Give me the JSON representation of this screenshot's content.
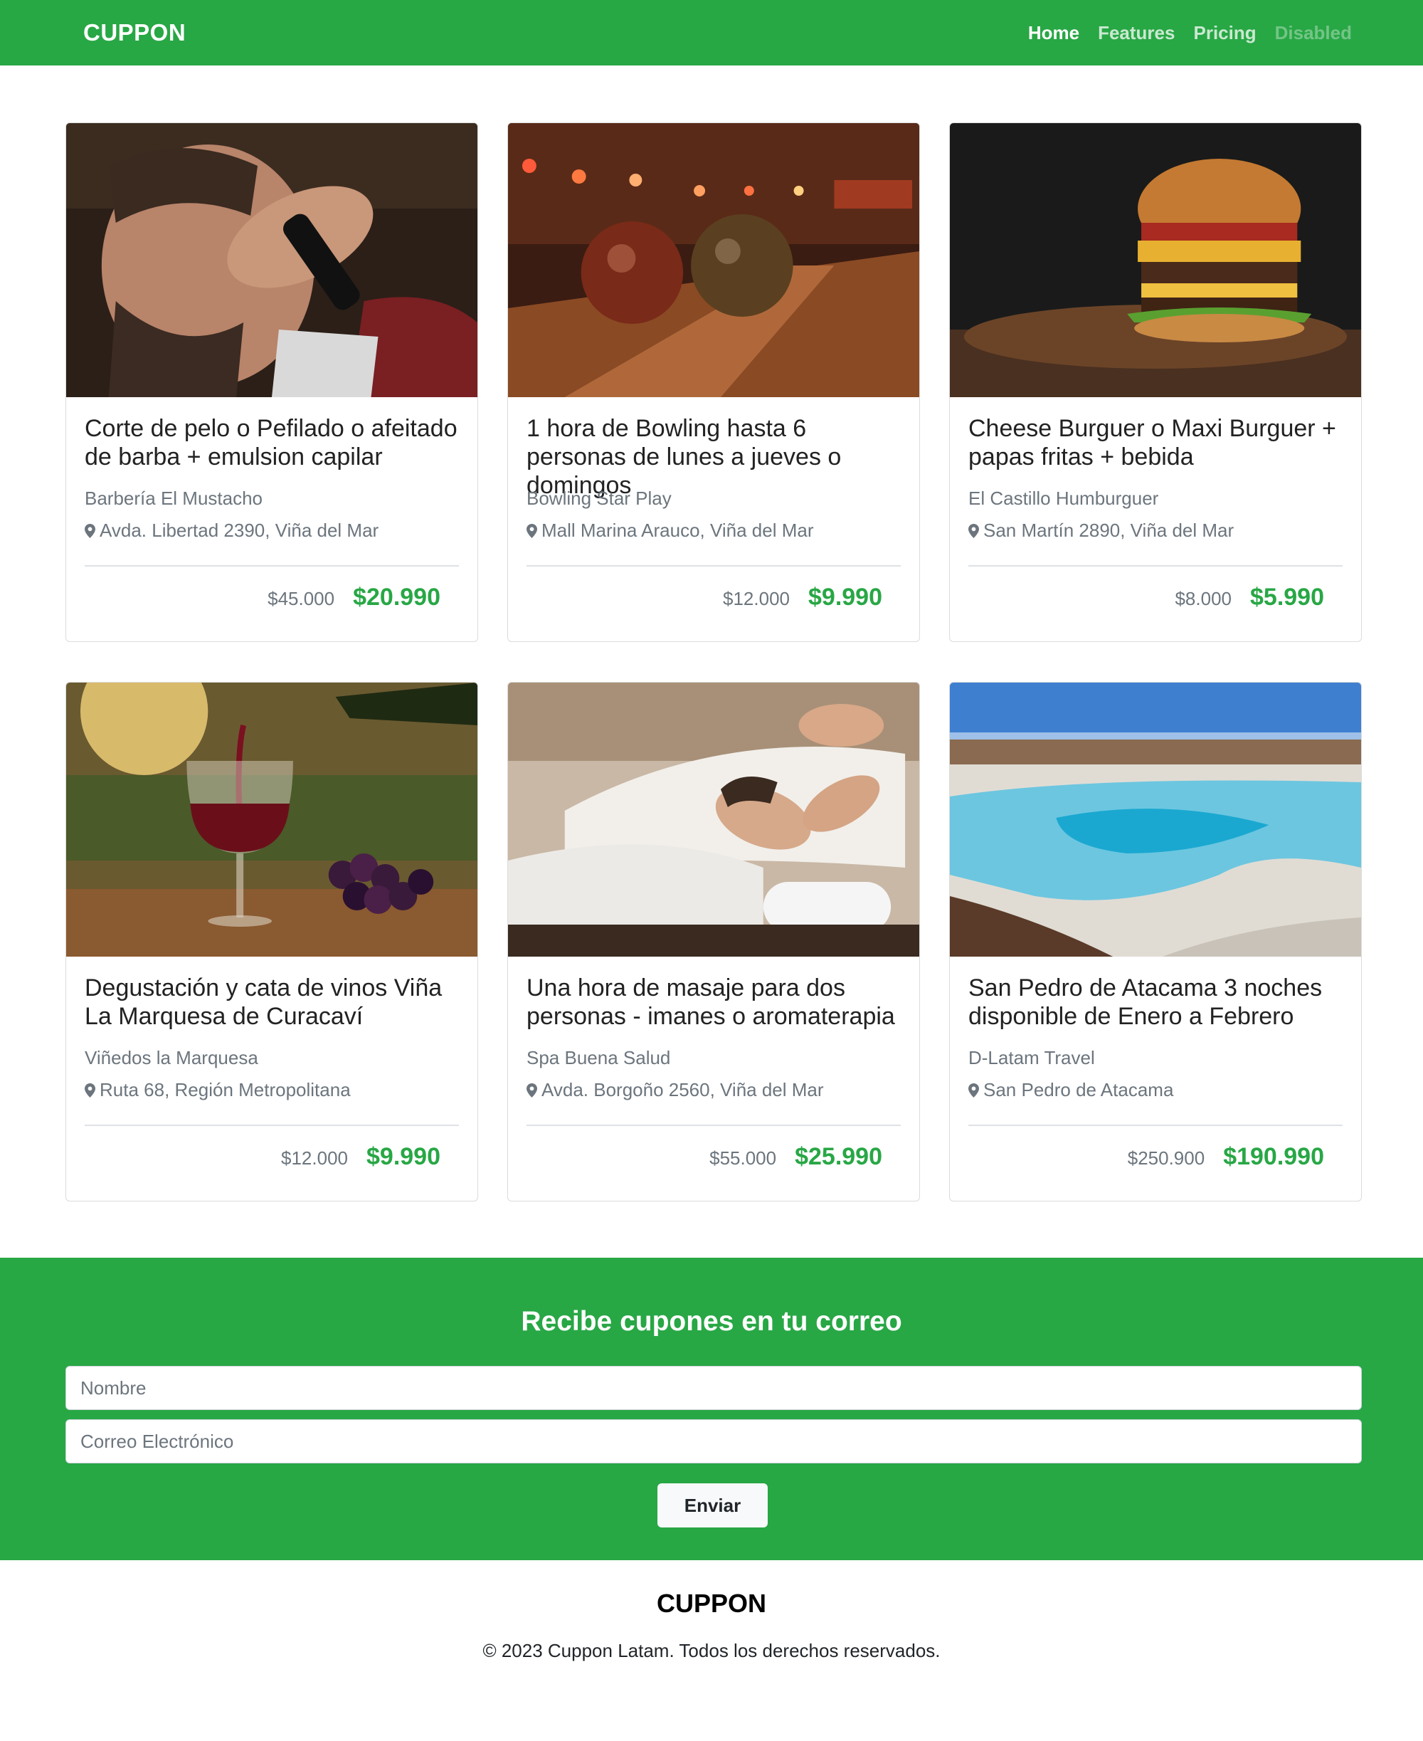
{
  "navbar": {
    "brand": "CUPPON",
    "links": [
      {
        "label": "Home",
        "state": "active"
      },
      {
        "label": "Features",
        "state": "normal"
      },
      {
        "label": "Pricing",
        "state": "normal"
      },
      {
        "label": "Disabled",
        "state": "disabled"
      }
    ]
  },
  "cards": [
    {
      "title": "Corte de pelo o Pefilado o afeitado de barba + emulsion capilar",
      "merchant": "Barbería El Mustacho",
      "address": "Avda. Libertad 2390, Viña del Mar",
      "old_price": "$45.000",
      "new_price": "$20.990",
      "image": "barber-photo"
    },
    {
      "title": "1 hora de Bowling hasta 6 personas de lunes a jueves o domingos",
      "merchant": "Bowling Star Play",
      "address": "Mall Marina Arauco, Viña del Mar",
      "old_price": "$12.000",
      "new_price": "$9.990",
      "image": "bowling-photo"
    },
    {
      "title": "Cheese Burguer o Maxi Burguer + papas fritas + bebida",
      "merchant": "El Castillo Humburguer",
      "address": "San Martín 2890, Viña del Mar",
      "old_price": "$8.000",
      "new_price": "$5.990",
      "image": "burger-photo"
    },
    {
      "title": "Degustación y cata de vinos Viña La Marquesa de Curacaví",
      "merchant": "Viñedos la Marquesa",
      "address": "Ruta 68, Región Metropolitana",
      "old_price": "$12.000",
      "new_price": "$9.990",
      "image": "wine-photo"
    },
    {
      "title": "Una hora de masaje para dos personas - imanes o aromaterapia",
      "merchant": "Spa Buena Salud",
      "address": "Avda. Borgoño 2560, Viña del Mar",
      "old_price": "$55.000",
      "new_price": "$25.990",
      "image": "massage-photo"
    },
    {
      "title": "San Pedro de Atacama 3 noches disponible de Enero a Febrero",
      "merchant": "D-Latam Travel",
      "address": "San Pedro de Atacama",
      "old_price": "$250.900",
      "new_price": "$190.990",
      "image": "atacama-photo"
    }
  ],
  "newsletter": {
    "heading": "Recibe cupones en tu correo",
    "name_placeholder": "Nombre",
    "email_placeholder": "Correo Electrónico",
    "submit_label": "Enviar"
  },
  "footer": {
    "brand": "CUPPON",
    "copyright": "© 2023 Cuppon Latam. Todos los derechos reservados."
  },
  "colors": {
    "brand_green": "#28a745",
    "muted_text": "#6c757d"
  },
  "icons": {
    "location": "map-pin-icon"
  }
}
